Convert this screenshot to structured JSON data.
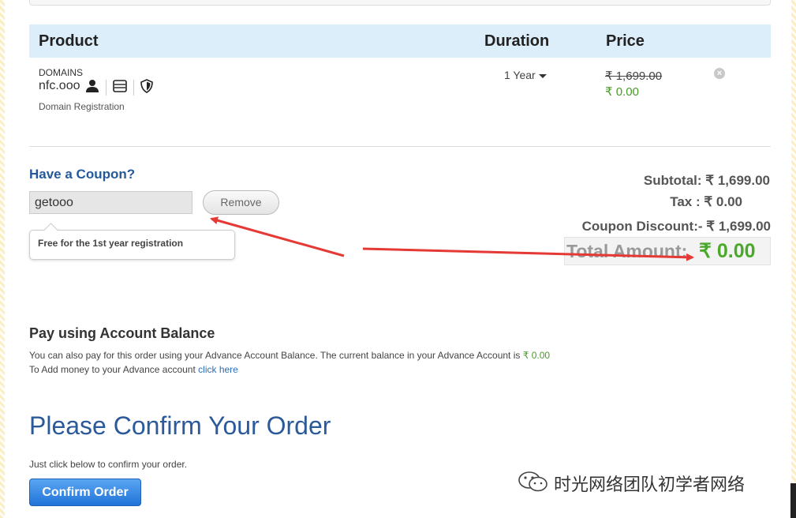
{
  "table": {
    "headers": {
      "product": "Product",
      "duration": "Duration",
      "price": "Price"
    },
    "row": {
      "category": "DOMAINS",
      "domain": "nfc.ooo",
      "type": "Domain Registration",
      "icons": [
        "user-icon",
        "server-icon",
        "shield-icon"
      ],
      "duration": "1 Year",
      "original_price": "₹ 1,699.00",
      "price": "₹ 0.00",
      "remove_icon": "close-icon"
    }
  },
  "coupon": {
    "title": "Have a Coupon?",
    "code": "getooo",
    "remove_label": "Remove",
    "message": "Free for the 1st year registration"
  },
  "summary": {
    "subtotal_label": "Subtotal:",
    "subtotal_value": "₹ 1,699.00",
    "tax_label": "Tax :",
    "tax_value": "₹ 0.00",
    "discount_label": "Coupon Discount:-",
    "discount_value": "₹ 1,699.00",
    "total_label": "Total Amount:",
    "total_value": "₹ 0.00"
  },
  "account_balance": {
    "title": "Pay using Account Balance",
    "line1": "You can also pay for this order using your Advance Account Balance. The current balance in your Advance Account is",
    "balance": "₹ 0.00",
    "line2": "To Add money to your Advance account",
    "link": "click here"
  },
  "confirm": {
    "title": "Please Confirm Your Order",
    "subtitle": "Just click below to confirm your order.",
    "button": "Confirm Order"
  },
  "watermark": {
    "text": "时光网络团队初学者网络",
    "icon": "wechat-icon"
  },
  "colors": {
    "header_bg": "#ddeefb",
    "accent_blue": "#23599b",
    "green": "#4aa82a",
    "button_blue": "#2173d8",
    "arrow_red": "#e53935"
  }
}
